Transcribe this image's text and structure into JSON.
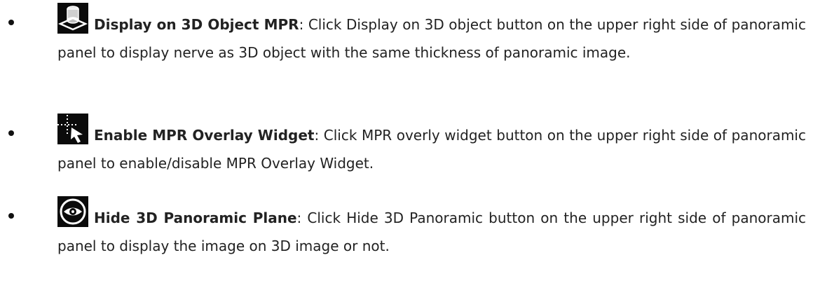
{
  "items": [
    {
      "icon": "3d-object-icon",
      "title": "Display on 3D Object MPR",
      "description": ": Click Display on 3D object button on the upper right side of panoramic panel to display nerve as 3D object with the same thickness of panoramic image."
    },
    {
      "icon": "mpr-overlay-widget-icon",
      "title": "Enable MPR Overlay Widget",
      "description": ": Click MPR overly widget button on the upper right side of panoramic panel to enable/disable MPR Overlay Widget."
    },
    {
      "icon": "eye-icon",
      "title": "Hide 3D Panoramic Plane",
      "description": ": Click Hide 3D Panoramic button on the upper right side of panoramic panel to display the image on 3D image or not."
    }
  ]
}
